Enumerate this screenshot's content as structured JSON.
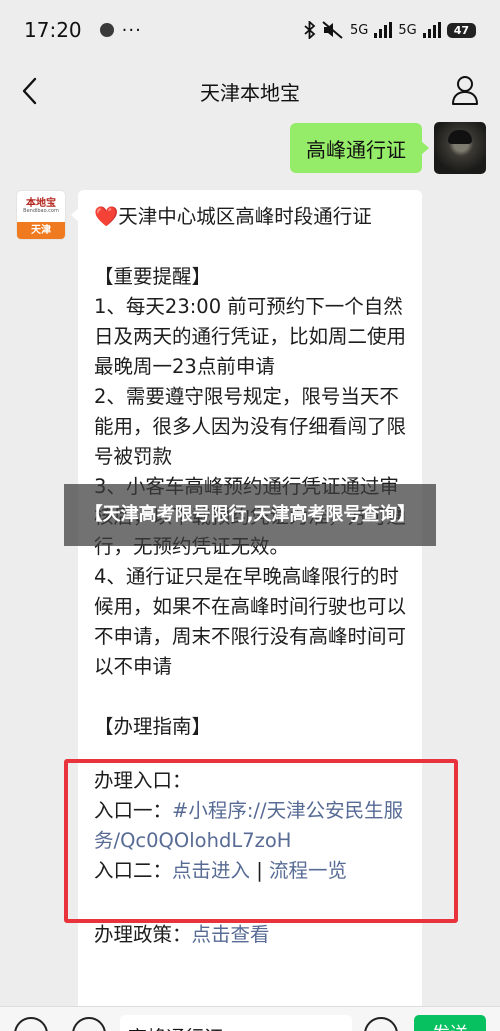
{
  "status_bar": {
    "time": "17:20",
    "dots": "···",
    "network_1": "5G",
    "network_2": "5G",
    "battery": "47"
  },
  "header": {
    "title": "天津本地宝"
  },
  "user_message": {
    "text": "高峰通行证"
  },
  "bot": {
    "avatar_logo": "本地宝",
    "avatar_sub": "Bendibao.com",
    "avatar_city": "天津",
    "heart": "❤️",
    "title": "天津中心城区高峰时段通行证",
    "section1": "【重要提醒】",
    "line1": "1、每天23:00 前可预约下一个自然日及两天的通行凭证，比如周二使用最晚周一23点前申请",
    "line2": "2、需要遵守限号规定，限号当天不能用，很多人因为没有仔细看闯了限号被罚款",
    "line3": "3、小客车高峰预约通行凭证通过审核后，以下载预约凭证为准，方可通行，无预约凭证无效。",
    "line4": "4、通行证只是在早晚高峰限行的时候用，如果不在高峰时间行驶也可以不申请，周末不限行没有高峰时间可以不申请",
    "section2": "【办理指南】",
    "entry_title": "办理入口：",
    "entry1_label": "入口一：",
    "entry1_link": "#小程序://天津公安民生服务/Qc0QOlohdL7zoH",
    "entry2_label": "入口二：",
    "entry2_link_a": "点击进入",
    "entry2_sep": "|",
    "entry2_link_b": "流程一览",
    "policy_label": "办理政策：",
    "policy_link": "点击查看"
  },
  "banner": {
    "text": "【天津高考限号限行,天津高考限号查询】"
  },
  "input_bar": {
    "value": "高峰通行证",
    "send_label": "发送"
  },
  "colors": {
    "user_bubble": "#95ec69",
    "link": "#576b95",
    "highlight_box": "#e8323c",
    "send_button": "#07c160"
  }
}
